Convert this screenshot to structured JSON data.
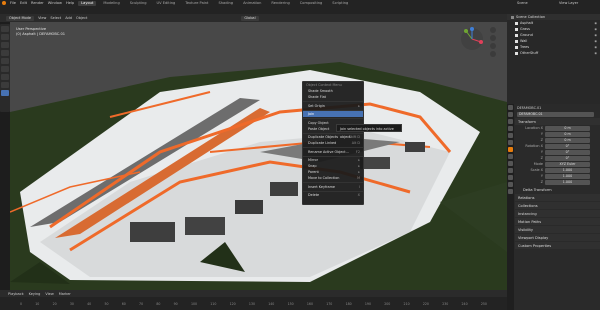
{
  "topbar": {
    "menus": [
      "File",
      "Edit",
      "Render",
      "Window",
      "Help"
    ],
    "tabs": [
      "Layout",
      "Modeling",
      "Sculpting",
      "UV Editing",
      "Texture Paint",
      "Shading",
      "Animation",
      "Rendering",
      "Compositing",
      "Scripting"
    ],
    "scene": "Scene",
    "view_layer": "View Layer"
  },
  "viewport_header": {
    "mode": "Object Mode",
    "menus": [
      "View",
      "Select",
      "Add",
      "Object"
    ],
    "orientation": "Global"
  },
  "viewport": {
    "perspective": "User Perspective",
    "collection_info": "(0) Asphalt | DEFAMOBC.01"
  },
  "context_menu": {
    "title": "Object Context Menu",
    "items": [
      {
        "label": "Shade Smooth",
        "shortcut": ""
      },
      {
        "label": "Shade Flat",
        "shortcut": ""
      },
      {
        "label": "Set Origin",
        "shortcut": "▸"
      },
      {
        "label": "Join",
        "shortcut": "",
        "selected": true
      },
      {
        "label": "Copy Object",
        "shortcut": ""
      },
      {
        "label": "Paste Object",
        "shortcut": ""
      },
      {
        "label": "Duplicate Objects",
        "shortcut": "Shift D"
      },
      {
        "label": "Duplicate Linked",
        "shortcut": "Alt D"
      },
      {
        "label": "Rename Active Object...",
        "shortcut": "F2"
      },
      {
        "label": "Mirror",
        "shortcut": "▸"
      },
      {
        "label": "Snap",
        "shortcut": "▸"
      },
      {
        "label": "Parent",
        "shortcut": "▸"
      },
      {
        "label": "Move to Collection",
        "shortcut": "M"
      },
      {
        "label": "Insert Keyframe",
        "shortcut": "I"
      },
      {
        "label": "Delete",
        "shortcut": "X"
      }
    ],
    "tooltip": "Join selected objects into active object."
  },
  "outliner": {
    "title": "Scene Collection",
    "items": [
      "Asphalt",
      "Grass",
      "Ground",
      "Wall",
      "Trees",
      "OtherStuff"
    ]
  },
  "properties": {
    "object_name": "DEFAMOBC.01",
    "object_name2": "DEFAMOBC.01",
    "transform_label": "Transform",
    "location": {
      "label": "Location X",
      "x": "0 m",
      "y_label": "Y",
      "y": "0 m",
      "z_label": "Z",
      "z": "0 m"
    },
    "rotation": {
      "label": "Rotation X",
      "x": "0°",
      "y_label": "Y",
      "y": "0°",
      "z_label": "Z",
      "z": "0°"
    },
    "mode": {
      "label": "Mode",
      "value": "XYZ Euler"
    },
    "scale": {
      "label": "Scale X",
      "x": "1.000",
      "y_label": "Y",
      "y": "1.000",
      "z_label": "Z",
      "z": "1.000"
    },
    "sections": [
      "Delta Transform",
      "Relations",
      "Collections",
      "Instancing",
      "Motion Paths",
      "Visibility",
      "Viewport Display",
      "Custom Properties"
    ]
  },
  "timeline": {
    "menus": [
      "Playback",
      "Keying",
      "View",
      "Marker"
    ],
    "frames": [
      "0",
      "10",
      "20",
      "30",
      "40",
      "50",
      "60",
      "70",
      "80",
      "90",
      "100",
      "110",
      "120",
      "130",
      "140",
      "150",
      "160",
      "170",
      "180",
      "190",
      "200",
      "210",
      "220",
      "230",
      "240",
      "250"
    ]
  },
  "colors": {
    "accent": "#e87d0d",
    "selection": "#4772b3"
  }
}
